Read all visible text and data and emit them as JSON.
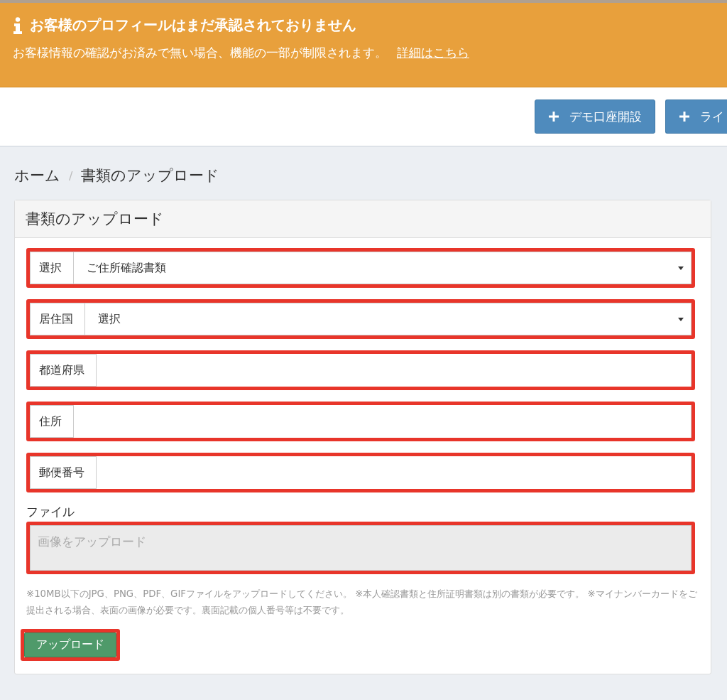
{
  "alert": {
    "title": "お客様のプロフィールはまだ承認されておりません",
    "message": "お客様情報の確認がお済みで無い場合、機能の一部が制限されます。",
    "link": "詳細はこちら"
  },
  "header_buttons": [
    {
      "label": "デモ口座開設"
    },
    {
      "label": "ライ"
    }
  ],
  "breadcrumb": {
    "separator": "/",
    "items": [
      {
        "label": "ホーム"
      },
      {
        "label": "書類のアップロード"
      }
    ]
  },
  "panel": {
    "title": "書類のアップロード",
    "fields": [
      {
        "kind": "select",
        "label": "選択",
        "value": "ご住所確認書類",
        "highlighted": true
      },
      {
        "kind": "select",
        "label": "居住国",
        "value": "選択",
        "highlighted": true
      },
      {
        "kind": "text",
        "label": "都道府県",
        "highlighted": true
      },
      {
        "kind": "text",
        "label": "住所",
        "highlighted": true
      },
      {
        "kind": "text",
        "label": "郵便番号",
        "highlighted": true
      }
    ],
    "file": {
      "label": "ファイル",
      "placeholder": "画像をアップロード",
      "highlighted": true
    },
    "note": "※10MB以下のJPG、PNG、PDF、GIFファイルをアップロードしてください。 ※本人確認書類と住所証明書類は別の書類が必要です。 ※マイナンバーカードをご提出される場合、表面の画像が必要です。裏面記載の個人番号等は不要です。",
    "submit": {
      "label": "アップロード",
      "highlighted": true
    }
  }
}
